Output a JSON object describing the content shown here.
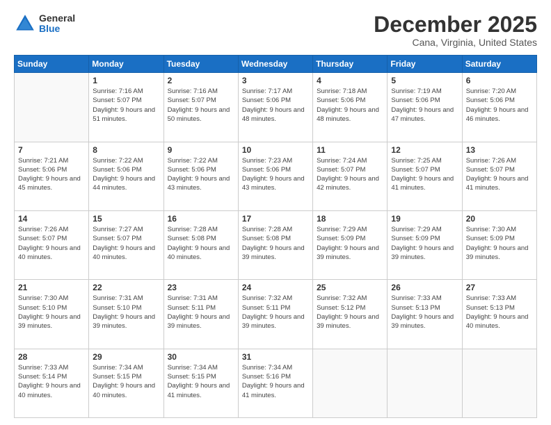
{
  "header": {
    "logo_general": "General",
    "logo_blue": "Blue",
    "month_title": "December 2025",
    "location": "Cana, Virginia, United States"
  },
  "days_of_week": [
    "Sunday",
    "Monday",
    "Tuesday",
    "Wednesday",
    "Thursday",
    "Friday",
    "Saturday"
  ],
  "weeks": [
    [
      {
        "day": "",
        "sunrise": "",
        "sunset": "",
        "daylight": ""
      },
      {
        "day": "1",
        "sunrise": "Sunrise: 7:16 AM",
        "sunset": "Sunset: 5:07 PM",
        "daylight": "Daylight: 9 hours and 51 minutes."
      },
      {
        "day": "2",
        "sunrise": "Sunrise: 7:16 AM",
        "sunset": "Sunset: 5:07 PM",
        "daylight": "Daylight: 9 hours and 50 minutes."
      },
      {
        "day": "3",
        "sunrise": "Sunrise: 7:17 AM",
        "sunset": "Sunset: 5:06 PM",
        "daylight": "Daylight: 9 hours and 48 minutes."
      },
      {
        "day": "4",
        "sunrise": "Sunrise: 7:18 AM",
        "sunset": "Sunset: 5:06 PM",
        "daylight": "Daylight: 9 hours and 48 minutes."
      },
      {
        "day": "5",
        "sunrise": "Sunrise: 7:19 AM",
        "sunset": "Sunset: 5:06 PM",
        "daylight": "Daylight: 9 hours and 47 minutes."
      },
      {
        "day": "6",
        "sunrise": "Sunrise: 7:20 AM",
        "sunset": "Sunset: 5:06 PM",
        "daylight": "Daylight: 9 hours and 46 minutes."
      }
    ],
    [
      {
        "day": "7",
        "sunrise": "Sunrise: 7:21 AM",
        "sunset": "Sunset: 5:06 PM",
        "daylight": "Daylight: 9 hours and 45 minutes."
      },
      {
        "day": "8",
        "sunrise": "Sunrise: 7:22 AM",
        "sunset": "Sunset: 5:06 PM",
        "daylight": "Daylight: 9 hours and 44 minutes."
      },
      {
        "day": "9",
        "sunrise": "Sunrise: 7:22 AM",
        "sunset": "Sunset: 5:06 PM",
        "daylight": "Daylight: 9 hours and 43 minutes."
      },
      {
        "day": "10",
        "sunrise": "Sunrise: 7:23 AM",
        "sunset": "Sunset: 5:06 PM",
        "daylight": "Daylight: 9 hours and 43 minutes."
      },
      {
        "day": "11",
        "sunrise": "Sunrise: 7:24 AM",
        "sunset": "Sunset: 5:07 PM",
        "daylight": "Daylight: 9 hours and 42 minutes."
      },
      {
        "day": "12",
        "sunrise": "Sunrise: 7:25 AM",
        "sunset": "Sunset: 5:07 PM",
        "daylight": "Daylight: 9 hours and 41 minutes."
      },
      {
        "day": "13",
        "sunrise": "Sunrise: 7:26 AM",
        "sunset": "Sunset: 5:07 PM",
        "daylight": "Daylight: 9 hours and 41 minutes."
      }
    ],
    [
      {
        "day": "14",
        "sunrise": "Sunrise: 7:26 AM",
        "sunset": "Sunset: 5:07 PM",
        "daylight": "Daylight: 9 hours and 40 minutes."
      },
      {
        "day": "15",
        "sunrise": "Sunrise: 7:27 AM",
        "sunset": "Sunset: 5:07 PM",
        "daylight": "Daylight: 9 hours and 40 minutes."
      },
      {
        "day": "16",
        "sunrise": "Sunrise: 7:28 AM",
        "sunset": "Sunset: 5:08 PM",
        "daylight": "Daylight: 9 hours and 40 minutes."
      },
      {
        "day": "17",
        "sunrise": "Sunrise: 7:28 AM",
        "sunset": "Sunset: 5:08 PM",
        "daylight": "Daylight: 9 hours and 39 minutes."
      },
      {
        "day": "18",
        "sunrise": "Sunrise: 7:29 AM",
        "sunset": "Sunset: 5:09 PM",
        "daylight": "Daylight: 9 hours and 39 minutes."
      },
      {
        "day": "19",
        "sunrise": "Sunrise: 7:29 AM",
        "sunset": "Sunset: 5:09 PM",
        "daylight": "Daylight: 9 hours and 39 minutes."
      },
      {
        "day": "20",
        "sunrise": "Sunrise: 7:30 AM",
        "sunset": "Sunset: 5:09 PM",
        "daylight": "Daylight: 9 hours and 39 minutes."
      }
    ],
    [
      {
        "day": "21",
        "sunrise": "Sunrise: 7:30 AM",
        "sunset": "Sunset: 5:10 PM",
        "daylight": "Daylight: 9 hours and 39 minutes."
      },
      {
        "day": "22",
        "sunrise": "Sunrise: 7:31 AM",
        "sunset": "Sunset: 5:10 PM",
        "daylight": "Daylight: 9 hours and 39 minutes."
      },
      {
        "day": "23",
        "sunrise": "Sunrise: 7:31 AM",
        "sunset": "Sunset: 5:11 PM",
        "daylight": "Daylight: 9 hours and 39 minutes."
      },
      {
        "day": "24",
        "sunrise": "Sunrise: 7:32 AM",
        "sunset": "Sunset: 5:11 PM",
        "daylight": "Daylight: 9 hours and 39 minutes."
      },
      {
        "day": "25",
        "sunrise": "Sunrise: 7:32 AM",
        "sunset": "Sunset: 5:12 PM",
        "daylight": "Daylight: 9 hours and 39 minutes."
      },
      {
        "day": "26",
        "sunrise": "Sunrise: 7:33 AM",
        "sunset": "Sunset: 5:13 PM",
        "daylight": "Daylight: 9 hours and 39 minutes."
      },
      {
        "day": "27",
        "sunrise": "Sunrise: 7:33 AM",
        "sunset": "Sunset: 5:13 PM",
        "daylight": "Daylight: 9 hours and 40 minutes."
      }
    ],
    [
      {
        "day": "28",
        "sunrise": "Sunrise: 7:33 AM",
        "sunset": "Sunset: 5:14 PM",
        "daylight": "Daylight: 9 hours and 40 minutes."
      },
      {
        "day": "29",
        "sunrise": "Sunrise: 7:34 AM",
        "sunset": "Sunset: 5:15 PM",
        "daylight": "Daylight: 9 hours and 40 minutes."
      },
      {
        "day": "30",
        "sunrise": "Sunrise: 7:34 AM",
        "sunset": "Sunset: 5:15 PM",
        "daylight": "Daylight: 9 hours and 41 minutes."
      },
      {
        "day": "31",
        "sunrise": "Sunrise: 7:34 AM",
        "sunset": "Sunset: 5:16 PM",
        "daylight": "Daylight: 9 hours and 41 minutes."
      },
      {
        "day": "",
        "sunrise": "",
        "sunset": "",
        "daylight": ""
      },
      {
        "day": "",
        "sunrise": "",
        "sunset": "",
        "daylight": ""
      },
      {
        "day": "",
        "sunrise": "",
        "sunset": "",
        "daylight": ""
      }
    ]
  ]
}
